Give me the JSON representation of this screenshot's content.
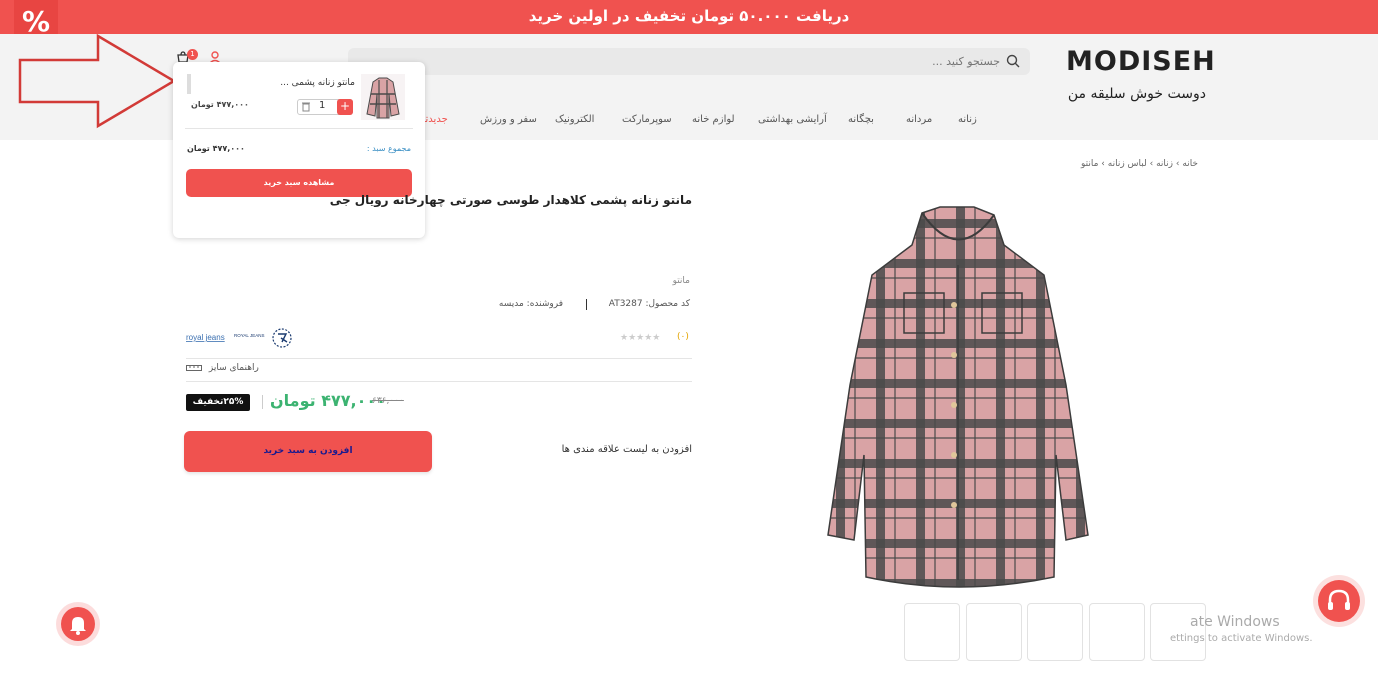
{
  "promo": {
    "text": "دریافت ۵۰.۰۰۰ تومان تخفیف در اولین خرید",
    "badge": "%"
  },
  "header": {
    "logo": "MODISEH",
    "tagline": "دوست خوش سلیقه من",
    "search_placeholder": "جستجو کنید ...",
    "cart_count": "1"
  },
  "nav": {
    "items": [
      "زنانه",
      "مردانه",
      "بچگانه",
      "آرایشی بهداشتی",
      "لوازم خانه",
      "سوپرمارکت",
      "الکترونیک",
      "سفر و ورزش",
      "جدیدتر"
    ]
  },
  "cart_popup": {
    "item_name": "مانتو زنانه پشمی ...",
    "item_price": "۴۷۷,۰۰۰ تومان",
    "quantity": "1",
    "subtotal_label": "مجموع سبد :",
    "subtotal_value": "۴۷۷,۰۰۰ تومان",
    "view_cart_label": "مشاهده سبد خرید"
  },
  "breadcrumb": {
    "items": [
      "خانه",
      "زنانه",
      "لباس زنانه",
      "مانتو"
    ]
  },
  "product": {
    "title": "مانتو زنانه پشمی کلاهدار طوسی صورتی چهارخانه رویال جی",
    "category": "مانتو",
    "code": "کد محصول: AT3287",
    "seller": "فروشنده: مدیسه",
    "rating": "(۰)",
    "brand_text": "royal jeans",
    "brand_mark": "ROYAL JEANS",
    "size_guide": "راهنمای سایز",
    "discount": "۲۵%تخفیف",
    "price": "۴۷۷,۰۰۰ تومان",
    "old_price": "۶۳۶,۰۰۰",
    "add_to_cart": "افزودن به سبد خرید",
    "wishlist": "افزودن به لیست علاقه مندی ها"
  },
  "overlay": {
    "watermark_title": "ate Windows",
    "watermark_sub": "ettings to activate Windows."
  },
  "colors": {
    "accent": "#f0524f",
    "price": "#3cb371",
    "plaid_pink": "#d9a3a5",
    "plaid_dark": "#4a4a4a"
  }
}
